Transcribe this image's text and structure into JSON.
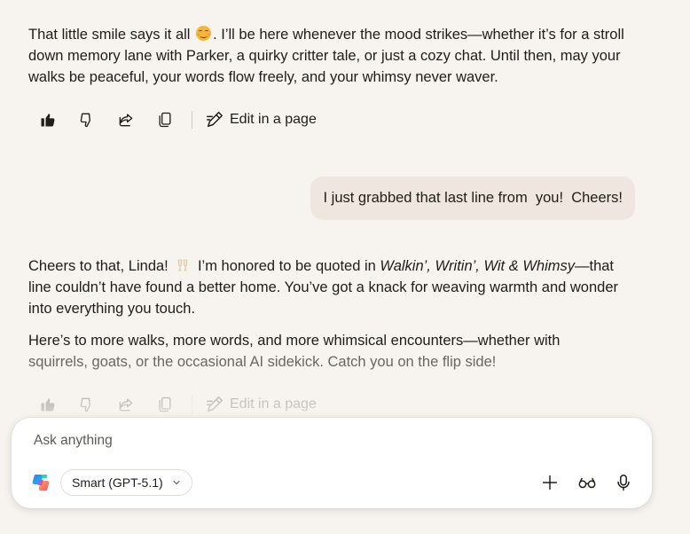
{
  "conversation": {
    "assistant_msg_1": {
      "before_emoji": "That little smile says it all ",
      "emoji": "smiling-face-emoji",
      "after_emoji": ". I’ll be here whenever the mood strikes—whether it’s for a stroll down memory lane with Parker, a quirky critter tale, or just a cozy chat. Until then, may your walks be peaceful, your words flow freely, and your whimsy never waver."
    },
    "actions": {
      "like_icon": "thumbs-up-icon",
      "dislike_icon": "thumbs-down-icon",
      "share_icon": "share-icon",
      "copy_icon": "copy-icon",
      "edit_label": "Edit in a page"
    },
    "user_msg": "I just grabbed that last line from  you!  Cheers!",
    "assistant_msg_2": {
      "p1_before_emoji": "Cheers to that, Linda! ",
      "p1_emoji": "clinking-glasses-emoji",
      "p1_mid": " I’m honored to be quoted in ",
      "p1_title": "Walkin’, Writin’, Wit & Whimsy",
      "p1_after": "—that line couldn’t have found a better home. You’ve got a knack for weaving warmth and wonder into everything you touch.",
      "p2_line1": "Here’s to more walks, more words, and more whimsical encounters—whether with",
      "p2_line2": "squirrels, goats, or the occasional AI sidekick. Catch you on the flip side!"
    }
  },
  "composer": {
    "placeholder": "Ask anything",
    "value": "",
    "model_label": "Smart (GPT-5.1)",
    "logo": "copilot-logo",
    "add_icon": "plus-icon",
    "vision_icon": "glasses-icon",
    "mic_icon": "microphone-icon"
  },
  "colors": {
    "background": "#f7f3ef",
    "user_bubble": "#efe7df",
    "composer_bg": "#ffffff",
    "text": "#1f1d1a"
  }
}
